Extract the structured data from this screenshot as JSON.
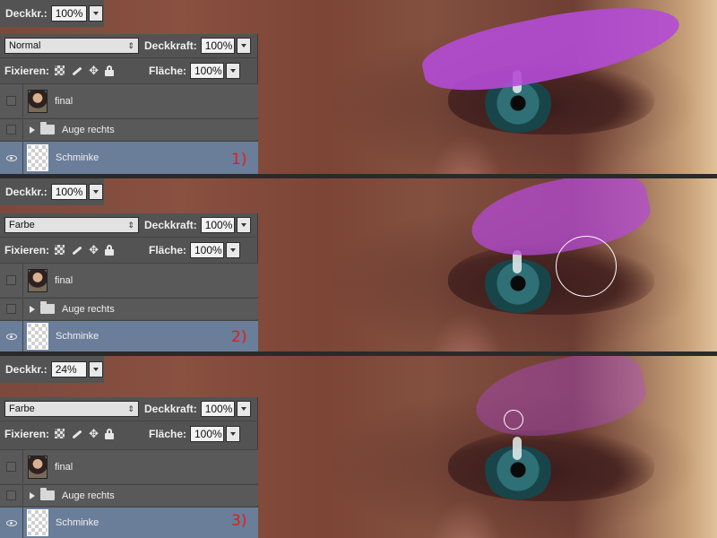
{
  "panels": [
    {
      "opacity_label": "Deckkr.:",
      "opacity_value": "100%",
      "blend_mode": "Normal",
      "deckkraft_label": "Deckkraft:",
      "deckkraft_value": "100%",
      "fixieren_label": "Fixieren:",
      "flaeche_label": "Fläche:",
      "flaeche_value": "100%",
      "layers": [
        {
          "name": "final"
        },
        {
          "name": "Auge rechts"
        },
        {
          "name": "Schminke"
        }
      ],
      "step_label": "1)"
    },
    {
      "opacity_label": "Deckkr.:",
      "opacity_value": "100%",
      "blend_mode": "Farbe",
      "deckkraft_label": "Deckkraft:",
      "deckkraft_value": "100%",
      "fixieren_label": "Fixieren:",
      "flaeche_label": "Fläche:",
      "flaeche_value": "100%",
      "layers": [
        {
          "name": "final"
        },
        {
          "name": "Auge rechts"
        },
        {
          "name": "Schminke"
        }
      ],
      "step_label": "2)"
    },
    {
      "opacity_label": "Deckkr.:",
      "opacity_value": "24%",
      "blend_mode": "Farbe",
      "deckkraft_label": "Deckkraft:",
      "deckkraft_value": "100%",
      "fixieren_label": "Fixieren:",
      "flaeche_label": "Fläche:",
      "flaeche_value": "100%",
      "layers": [
        {
          "name": "final"
        },
        {
          "name": "Auge rechts"
        },
        {
          "name": "Schminke"
        }
      ],
      "step_label": "3)"
    }
  ],
  "colors": {
    "eyeshadow": "#b44bd6",
    "selected_layer": "#6a7d99",
    "step_label": "#e51b1b",
    "panel_bg": "#535353"
  },
  "icons": [
    "checkerboard-lock-icon",
    "brush-lock-icon",
    "move-lock-icon",
    "padlock-icon",
    "eye-icon",
    "folder-icon",
    "disclosure-triangle-icon"
  ]
}
